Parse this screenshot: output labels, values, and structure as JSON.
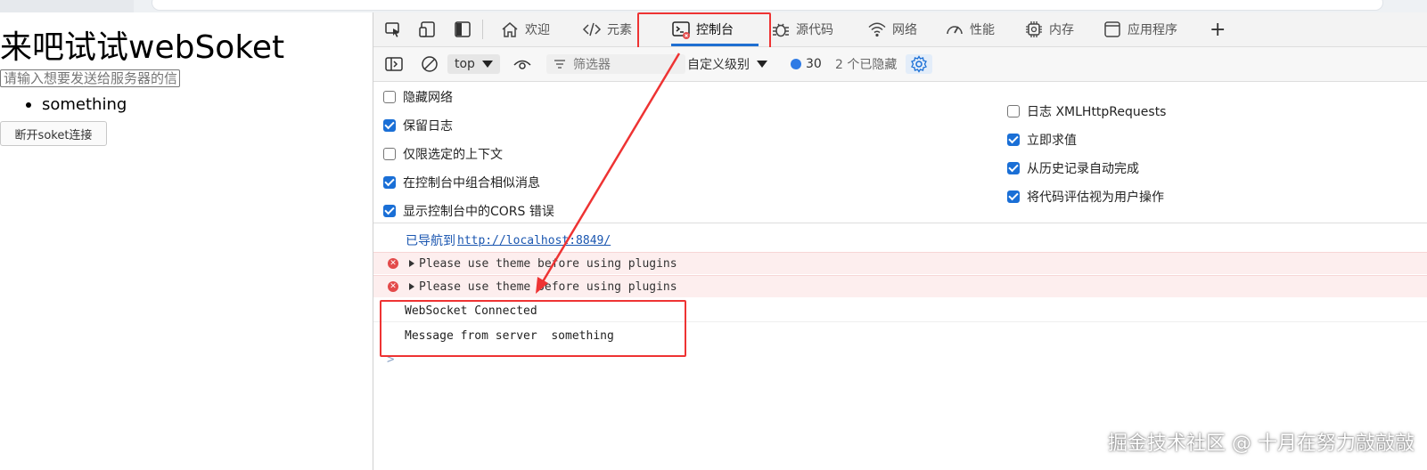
{
  "page": {
    "heading": "来吧试试webSoket",
    "input_placeholder": "请输入想要发送给服务器的信",
    "list_items": [
      "something"
    ],
    "disconnect_button": "断开soket连接"
  },
  "devtools": {
    "tabs": [
      {
        "label": "欢迎",
        "icon": "home-icon"
      },
      {
        "label": "元素",
        "icon": "code-icon"
      },
      {
        "label": "控制台",
        "icon": "console-icon",
        "active": true
      },
      {
        "label": "源代码",
        "icon": "bug-icon"
      },
      {
        "label": "网络",
        "icon": "wifi-icon"
      },
      {
        "label": "性能",
        "icon": "gauge-icon"
      },
      {
        "label": "内存",
        "icon": "chip-icon"
      },
      {
        "label": "应用程序",
        "icon": "app-window-icon"
      }
    ],
    "add_tab": "+",
    "toolbar": {
      "context": "top",
      "filter_placeholder": "筛选器",
      "level": "自定义级别",
      "message_count": "30",
      "hidden": "2 个已隐藏"
    },
    "settings_left": [
      {
        "label": "隐藏网络",
        "checked": false
      },
      {
        "label": "保留日志",
        "checked": true
      },
      {
        "label": "仅限选定的上下文",
        "checked": false
      },
      {
        "label": "在控制台中组合相似消息",
        "checked": true
      },
      {
        "label": "显示控制台中的CORS 错误",
        "checked": true
      }
    ],
    "settings_right": [
      {
        "label": "日志 XMLHttpRequests",
        "checked": false
      },
      {
        "label": "立即求值",
        "checked": true
      },
      {
        "label": "从历史记录自动完成",
        "checked": true
      },
      {
        "label": "将代码评估视为用户操作",
        "checked": true
      }
    ],
    "console": {
      "nav_prefix": "已导航到",
      "nav_url": "http://localhost:8849/",
      "errors": [
        "Please use theme before using plugins",
        "Please use theme before using plugins"
      ],
      "logs": [
        "WebSocket Connected",
        "Message from server  something"
      ],
      "prompt": ">"
    }
  },
  "watermark": "掘金技术社区 @ 十月在努力敲敲敲",
  "colors": {
    "annotation": "#e33333",
    "active_tab_underline": "#1f6fd1",
    "checkbox": "#1a6fd6",
    "error_bg": "#fdeeee"
  }
}
